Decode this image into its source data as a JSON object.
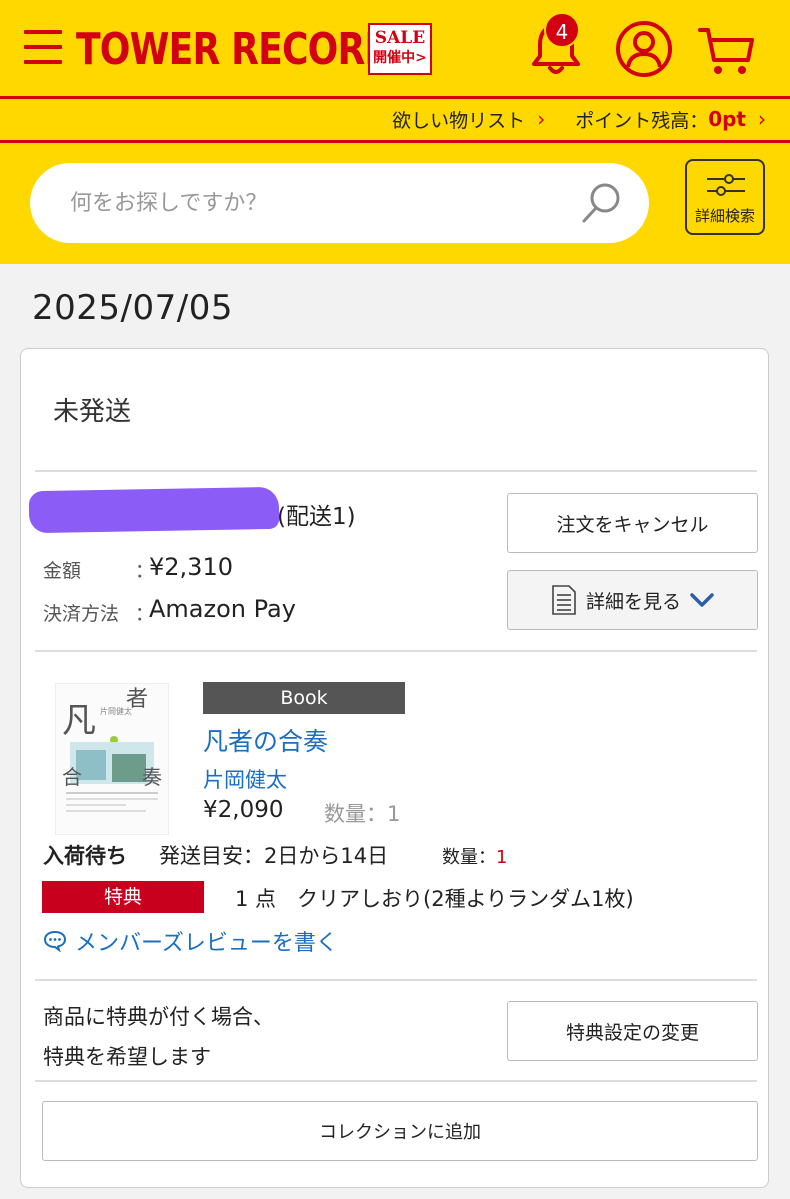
{
  "header": {
    "logo": "TOWER RECORDS",
    "sale_line1": "SALE",
    "sale_line2": "開催中>",
    "notification_count": "4",
    "wishlist_label": "欲しい物リスト",
    "points_label": "ポイント残高：",
    "points_value": "0pt",
    "chevron": "›",
    "search_placeholder": "何をお探しですか？",
    "advanced_search_label": "詳細検索"
  },
  "order": {
    "date": "2025/07/05",
    "status": "未発送",
    "order_id_suffix": "(配送1)",
    "amount_label": "金額",
    "amount_value": "¥2,310",
    "payment_label": "決済方法",
    "payment_value": "Amazon Pay",
    "colon": "：",
    "cancel_button": "注文をキャンセル",
    "detail_button": "詳細を見る"
  },
  "item": {
    "format": "Book",
    "title": "凡者の合奏",
    "author": "片岡健太",
    "price": "¥2,090",
    "qty_label": "数量：1",
    "availability": "入荷待ち",
    "ship_estimate": "発送目安：2日から14日",
    "qty2_label": "数量：",
    "qty2_value": "1",
    "perk_badge": "特典",
    "perk_text": "1 点　クリアしおり(2種よりランダム1枚)",
    "review_link": "メンバーズレビューを書く"
  },
  "perk_setting": {
    "note_line1": "商品に特典が付く場合、",
    "note_line2": "特典を希望します",
    "change_button": "特典設定の変更"
  },
  "collection_button": "コレクションに追加",
  "colors": {
    "brand_yellow": "#ffd800",
    "brand_red": "#d20010",
    "link_blue": "#1a6fc0",
    "redaction": "#8b5cf6"
  }
}
